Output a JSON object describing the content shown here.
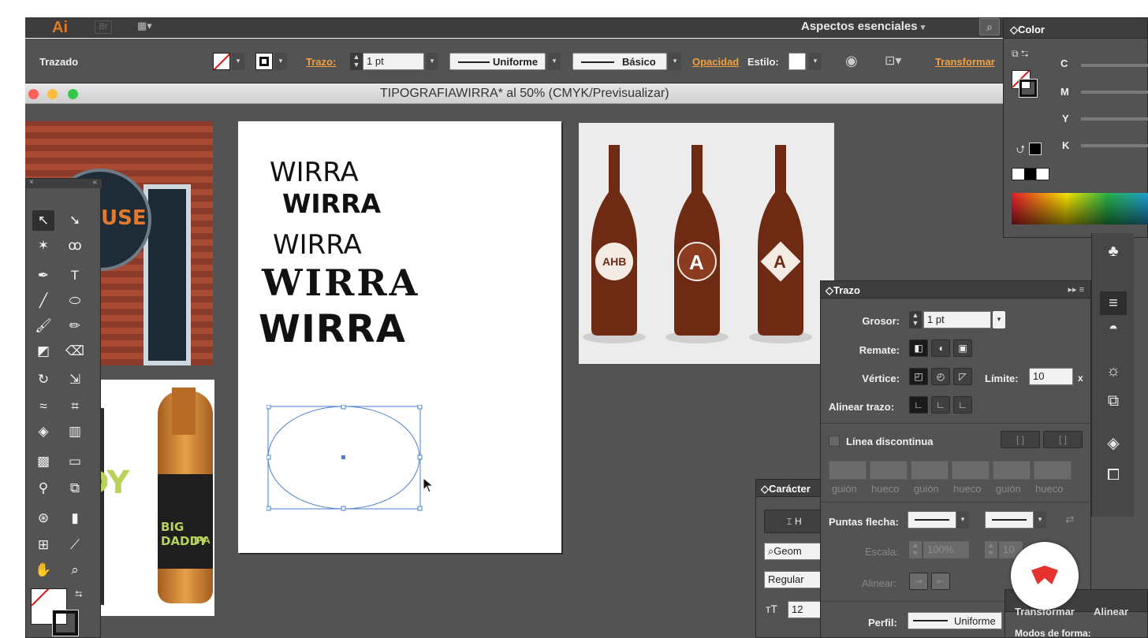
{
  "app": {
    "logo": "Ai",
    "bridge_label": "Br",
    "workspace_label": "Aspectos esenciales",
    "workspace_caret": "▾",
    "search_icon": "search-icon"
  },
  "control_bar": {
    "selection_type": "Trazado",
    "stroke_label": "Trazo:",
    "stroke_value": "1 pt",
    "profile_label": "Uniforme",
    "brush_label": "Básico",
    "opacity_label": "Opacidad",
    "style_label": "Estilo:",
    "transform_label": "Transformar"
  },
  "document": {
    "title": "TIPOGRAFIAWIRRA* al 50% (CMYK/Previsualizar)"
  },
  "artboard": {
    "words": [
      "WIRRA",
      "WIRRA",
      "WIRRA",
      "WIRRA",
      "WIRRA"
    ]
  },
  "bottles": {
    "labels": [
      "AHB",
      "A",
      "A"
    ]
  },
  "beer_art": {
    "sign_text": "USE",
    "box_text": "DDY",
    "bottle_text": "BIG DADDY",
    "bottle_sub": "IPA"
  },
  "color_panel": {
    "title": "Color",
    "channels": [
      "C",
      "M",
      "Y",
      "K"
    ]
  },
  "stroke_panel": {
    "title": "Trazo",
    "weight_label": "Grosor:",
    "weight_value": "1 pt",
    "cap_label": "Remate:",
    "corner_label": "Vértice:",
    "limit_label": "Límite:",
    "limit_value": "10",
    "limit_unit": "x",
    "align_label": "Alinear trazo:",
    "dashed_label": "Línea discontinua",
    "dash_labels": [
      "guión",
      "hueco",
      "guión",
      "hueco",
      "guión",
      "hueco"
    ],
    "arrowheads_label": "Puntas flecha:",
    "scale_label": "Escala:",
    "scale_value_1": "100%",
    "scale_value_2": "10",
    "align_arrow_label": "Alinear:",
    "profile_label": "Perfil:",
    "profile_value": "Uniforme"
  },
  "character_panel": {
    "title": "Carácter",
    "font_search": "Geom",
    "style": "Regular",
    "size_value": "12",
    "button_label": "H"
  },
  "transform_panel": {
    "tabs": [
      "Transformar",
      "Alinear"
    ],
    "shape_modes_label": "Modos de forma:"
  }
}
